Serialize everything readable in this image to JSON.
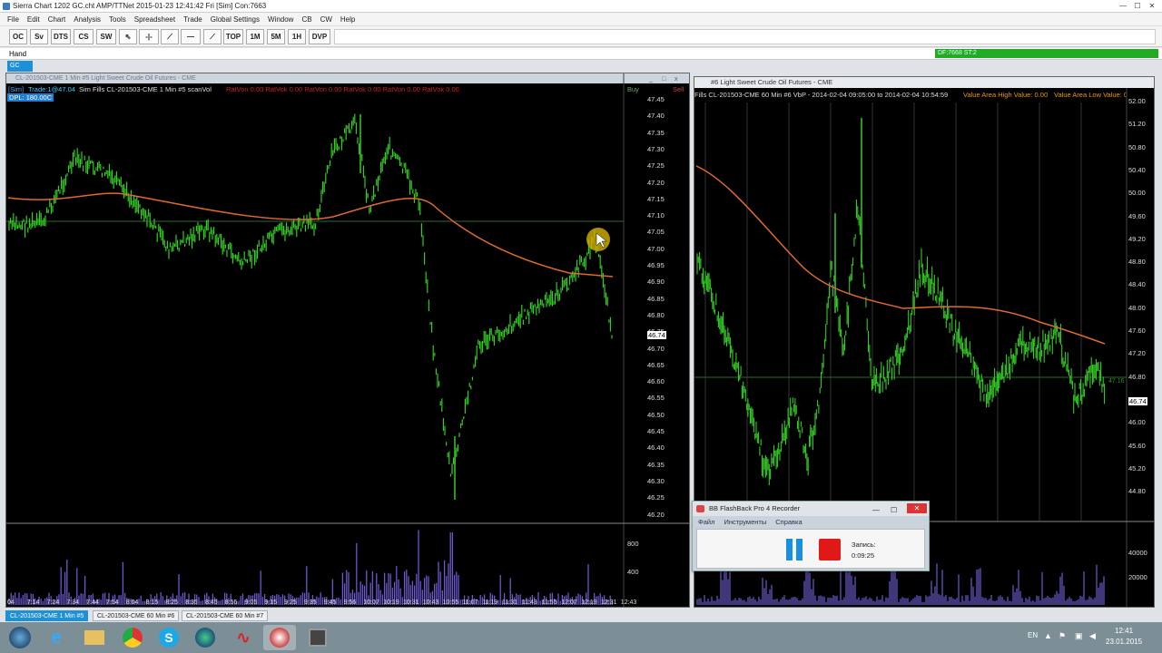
{
  "titlebar": {
    "title": "Sierra Chart 1202 GC.cht  AMP/TTNet 2015-01-23  12:41:42 Fri [Sim]  Con:7663"
  },
  "menu": [
    "File",
    "Edit",
    "Chart",
    "Analysis",
    "Tools",
    "Spreadsheet",
    "Trade",
    "Global Settings",
    "Window",
    "CB",
    "CW",
    "Help"
  ],
  "toolbar": {
    "buttons": [
      "OC",
      "Sv",
      "DTS",
      "CS",
      "SW",
      "TOP",
      "1M",
      "5M",
      "1H",
      "DVP"
    ]
  },
  "hand": {
    "label": "Hand",
    "df": "DF:7668  ST:2"
  },
  "gc_tab": "GC",
  "left_chart": {
    "window_title": "CL-201503-CME 1 Min  #5  Light Sweet Crude Oil Futures - CME",
    "status_sim": "[Sim]",
    "status_trade": "Trade:1@47.04",
    "status_main": "Sim Fills  CL-201503-CME 1 Min  #5  scanVol",
    "status_ratio": "RatVon 0.00  RatVok 0.00  RatVon 0.00  RatVok 0.00  RatVon 0.00  RatVok 0.00",
    "dpl": "DPL: 180.00C",
    "buy": "Buy",
    "sell": "Sell",
    "last_price": "46.74",
    "price_ticks": [
      "47.45",
      "47.40",
      "47.35",
      "47.30",
      "47.25",
      "47.20",
      "47.15",
      "47.10",
      "47.05",
      "47.00",
      "46.95",
      "46.90",
      "46.85",
      "46.80",
      "46.75",
      "46.70",
      "46.65",
      "46.60",
      "46.55",
      "46.50",
      "46.45",
      "46.40",
      "46.35",
      "46.30",
      "46.25",
      "46.20"
    ],
    "volume_ticks": [
      "800",
      "400"
    ],
    "time_ticks": [
      "04",
      "7:14",
      "7:24",
      "7:34",
      "7:44",
      "7:54",
      "8:04",
      "8:15",
      "8:25",
      "8:35",
      "8:45",
      "8:55",
      "9:05",
      "9:15",
      "9:25",
      "9:35",
      "9:45",
      "9:56",
      "10:07",
      "10:19",
      "10:31",
      "10:43",
      "10:55",
      "11:07",
      "11:19",
      "11:31",
      "11:43",
      "11:55",
      "12:07",
      "12:19",
      "12:31",
      "12:43"
    ]
  },
  "right_chart": {
    "window_title": "#6  Light Sweet Crude Oil Futures - CME",
    "status": "Fills  CL-201503-CME 60 Min  #6  VbP - 2014-02-04  09:05:00 to 2014-02-04  10:54:59",
    "vah": "Value Area High Value: 0.00",
    "val": "Value Area Low Value: 0",
    "price_ticks": [
      "52.00",
      "51.20",
      "50.80",
      "50.40",
      "50.00",
      "49.60",
      "49.20",
      "48.80",
      "48.40",
      "48.00",
      "47.60",
      "47.20",
      "46.80",
      "46.40",
      "46.00",
      "45.60",
      "45.20",
      "44.80"
    ],
    "last_price": "46.74",
    "ma_price": "47.16",
    "volume_ticks": [
      "40000",
      "20000"
    ]
  },
  "recorder": {
    "title": "BB FlashBack Pro 4 Recorder",
    "menu": [
      "Файл",
      "Инструменты",
      "Справка"
    ],
    "rec_label": "Запись:",
    "rec_time": "0:09:25"
  },
  "chart_tabs": [
    "CL-201503-CME 1 Min  #5",
    "CL-201503-CME  60 Min  #6",
    "CL-201503-CME  60 Min  #7"
  ],
  "taskbar": {
    "lang": "EN",
    "time": "12:41",
    "date": "23.01.2015"
  }
}
